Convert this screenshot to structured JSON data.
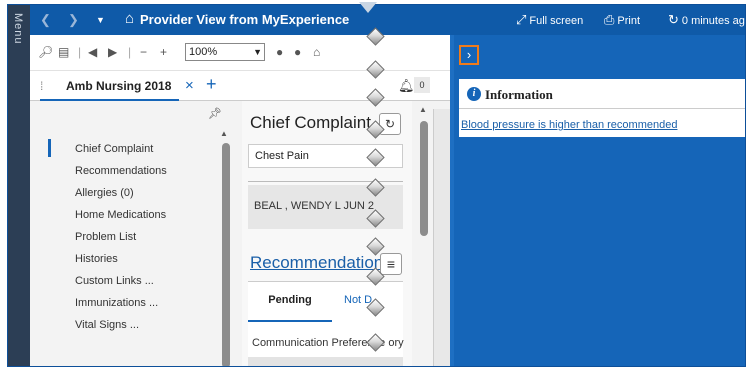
{
  "menu_label": "Menu",
  "topbar": {
    "back_icon": "chevron-left-icon",
    "forward_icon": "chevron-right-icon",
    "dropdown_icon": "caret-down-icon",
    "home_icon": "home-icon",
    "title": "Provider View from MyExperience",
    "fullscreen_label": "Full screen",
    "print_label": "Print",
    "refresh_label": "0 minutes ago"
  },
  "toolbar": {
    "zoom_value": "100%"
  },
  "tab": {
    "label": "Amb Nursing 2018",
    "close_symbol": "×",
    "add_symbol": "+",
    "notification_count": "0"
  },
  "sidebar": {
    "items": [
      "Chief Complaint",
      "Recommendations",
      "Allergies (0)",
      "Home Medications",
      "Problem List",
      "Histories",
      "Custom Links ...",
      "Immunizations ...",
      "Vital Signs ..."
    ],
    "active_index": 0
  },
  "chief_complaint": {
    "title": "Chief Complaint",
    "value": "Chest Pain",
    "patient_banner": "BEAL , WENDY L JUN 2"
  },
  "recommendations": {
    "title": "Recommendations",
    "tab_pending": "Pending",
    "tab_not_done": "Not D",
    "row_text": "Communication Preference ory"
  },
  "info_panel": {
    "title": "Information",
    "link_text": "Blood pressure is higher than recommended"
  },
  "colors": {
    "frame_blue": "#1565b8",
    "topbar_blue": "#0f5aa8",
    "accent_orange": "#f07b1a",
    "link_blue": "#1a5fa8"
  }
}
